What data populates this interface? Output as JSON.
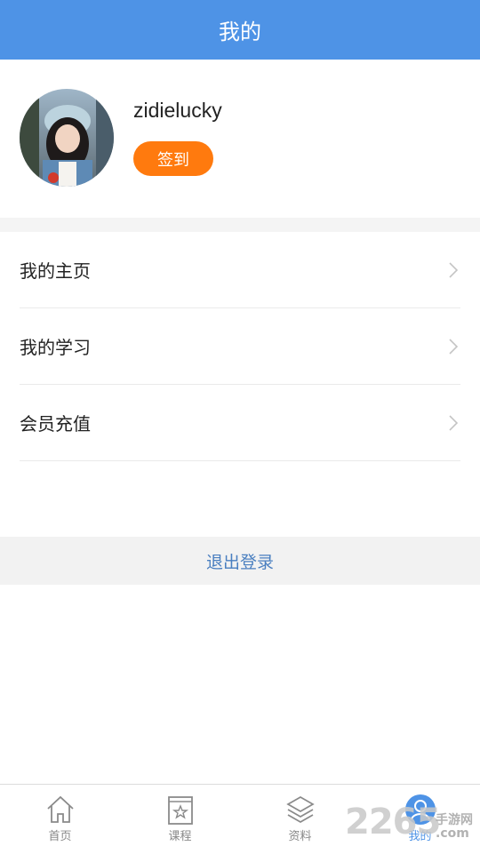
{
  "header": {
    "title": "我的"
  },
  "profile": {
    "username": "zidielucky",
    "signin_label": "签到"
  },
  "menu": {
    "items": [
      {
        "label": "我的主页",
        "icon": "chevron-right-icon"
      },
      {
        "label": "我的学习",
        "icon": "chevron-right-icon"
      },
      {
        "label": "会员充值",
        "icon": "chevron-right-icon"
      }
    ]
  },
  "logout": {
    "label": "退出登录"
  },
  "tabbar": {
    "items": [
      {
        "label": "首页",
        "icon": "home-icon",
        "active": false
      },
      {
        "label": "课程",
        "icon": "course-book-icon",
        "active": false
      },
      {
        "label": "资料",
        "icon": "layers-icon",
        "active": false
      },
      {
        "label": "我的",
        "icon": "user-icon",
        "active": true
      }
    ]
  },
  "watermark": {
    "number": "2265",
    "line1": "手游网",
    "line2": ".com"
  },
  "colors": {
    "header": "#4e93e6",
    "signin": "#ff7a0e",
    "logout_text": "#4a7fc0",
    "active_tab": "#4e93e6"
  }
}
